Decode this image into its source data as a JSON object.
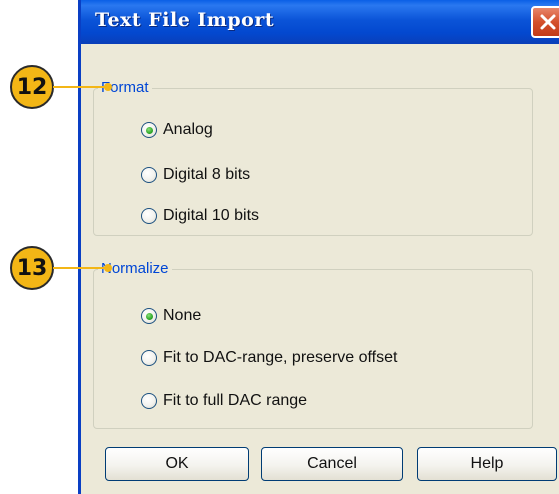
{
  "dialog": {
    "title": "Text File Import",
    "close_icon": "close-icon"
  },
  "format": {
    "legend": "Format",
    "options": [
      {
        "label": "Analog",
        "selected": true
      },
      {
        "label": "Digital 8 bits",
        "selected": false
      },
      {
        "label": "Digital 10 bits",
        "selected": false
      }
    ]
  },
  "normalize": {
    "legend": "Normalize",
    "options": [
      {
        "label": "None",
        "selected": true
      },
      {
        "label": "Fit to DAC-range, preserve offset",
        "selected": false
      },
      {
        "label": "Fit to full DAC range",
        "selected": false
      }
    ]
  },
  "buttons": {
    "ok": "OK",
    "cancel": "Cancel",
    "help": "Help"
  },
  "callouts": {
    "format": "12",
    "normalize": "13"
  },
  "colors": {
    "titlebar": "#0348cf",
    "dialog_bg": "#ece9d8",
    "legend_text": "#0046d5",
    "callout": "#f3b616",
    "close_button": "#d4502c",
    "radio_selected": "#2fa82a"
  }
}
